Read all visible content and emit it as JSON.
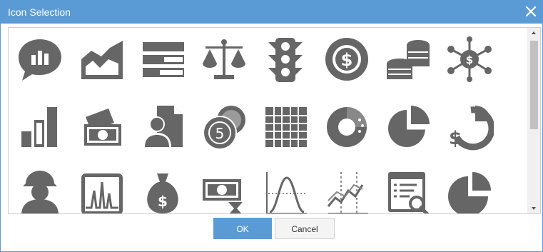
{
  "dialog": {
    "title": "Icon Selection",
    "ok_label": "OK",
    "cancel_label": "Cancel"
  },
  "icons": [
    "speech-bubble-bar-chart-icon",
    "area-chart-icon",
    "progress-bars-icon",
    "balance-scale-icon",
    "traffic-light-icon",
    "dollar-chip-icon",
    "coin-stacks-icon",
    "dollar-network-icon",
    "ascending-bars-icon",
    "banknotes-icon",
    "person-document-icon",
    "coins-five-icon",
    "calendar-grid-icon",
    "donut-chart-icon",
    "pie-chart-slice-icon",
    "dollar-pie-icon",
    "worker-helmet-icon",
    "spectrum-chart-icon",
    "money-bag-icon",
    "money-hourglass-icon",
    "bell-curve-icon",
    "scatter-line-chart-icon",
    "report-search-icon",
    "pie-chart-icon"
  ],
  "colors": {
    "accent": "#5b9bd5",
    "icon": "#666666"
  }
}
